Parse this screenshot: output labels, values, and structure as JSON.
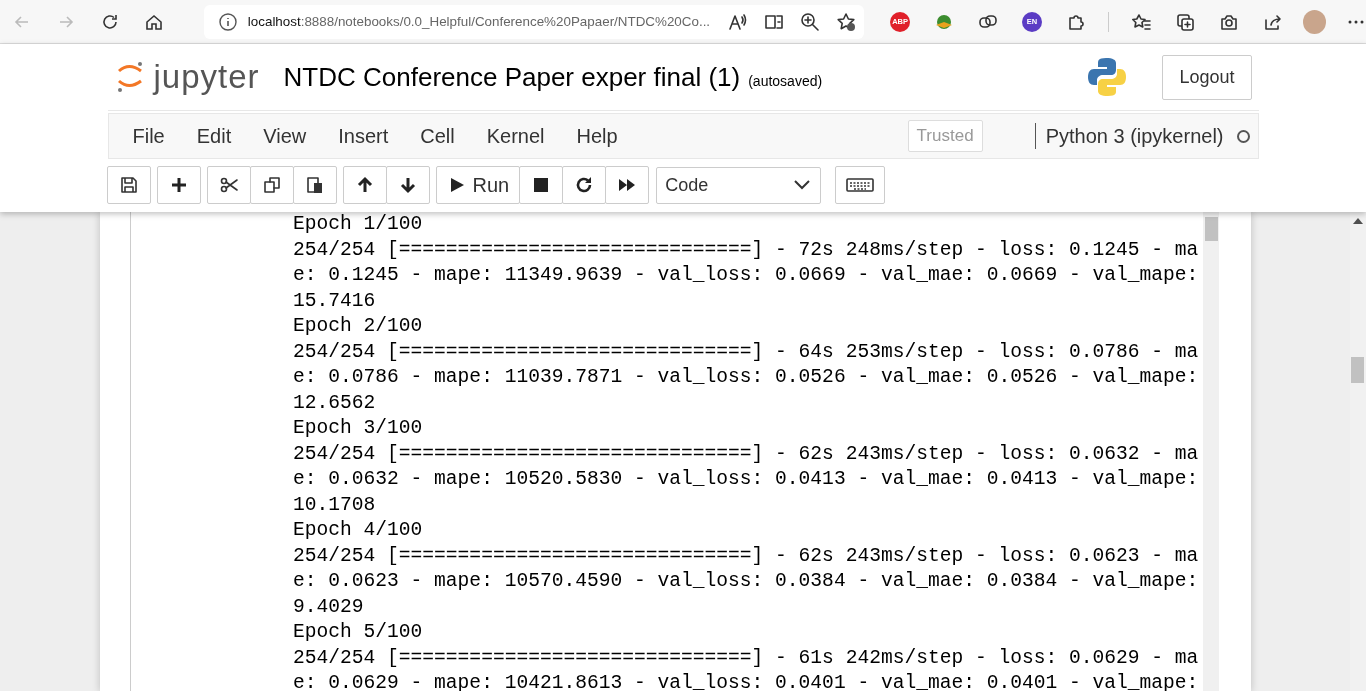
{
  "browser": {
    "url_host": "localhost",
    "url_rest": ":8888/notebooks/0.0_Helpful/Conference%20Papaer/NTDC%20Co...",
    "extensions": [
      {
        "label": "ABP",
        "color": "#e0202a"
      },
      {
        "label": "EN",
        "color": "#5b3cc4"
      }
    ]
  },
  "header": {
    "logo_text": "jupyter",
    "title": "NTDC Conference Paper exper final (1)",
    "save_status": "(autosaved)",
    "logout": "Logout"
  },
  "menubar": {
    "items": [
      "File",
      "Edit",
      "View",
      "Insert",
      "Cell",
      "Kernel",
      "Help"
    ],
    "trusted": "Trusted",
    "kernel": "Python 3 (ipykernel)",
    "kernel_busy": false
  },
  "toolbar": {
    "run_label": "Run",
    "cell_type": "Code"
  },
  "output": {
    "lines": [
      "Epoch 1/100",
      "254/254 [==============================] - 72s 248ms/step - loss: 0.1245 - ma",
      "e: 0.1245 - mape: 11349.9639 - val_loss: 0.0669 - val_mae: 0.0669 - val_mape:",
      "15.7416",
      "Epoch 2/100",
      "254/254 [==============================] - 64s 253ms/step - loss: 0.0786 - ma",
      "e: 0.0786 - mape: 11039.7871 - val_loss: 0.0526 - val_mae: 0.0526 - val_mape:",
      "12.6562",
      "Epoch 3/100",
      "254/254 [==============================] - 62s 243ms/step - loss: 0.0632 - ma",
      "e: 0.0632 - mape: 10520.5830 - val_loss: 0.0413 - val_mae: 0.0413 - val_mape:",
      "10.1708",
      "Epoch 4/100",
      "254/254 [==============================] - 62s 243ms/step - loss: 0.0623 - ma",
      "e: 0.0623 - mape: 10570.4590 - val_loss: 0.0384 - val_mae: 0.0384 - val_mape:",
      "9.4029",
      "Epoch 5/100",
      "254/254 [==============================] - 61s 242ms/step - loss: 0.0629 - ma",
      "e: 0.0629 - mape: 10421.8613 - val_loss: 0.0401 - val_mae: 0.0401 - val_mape:"
    ]
  }
}
